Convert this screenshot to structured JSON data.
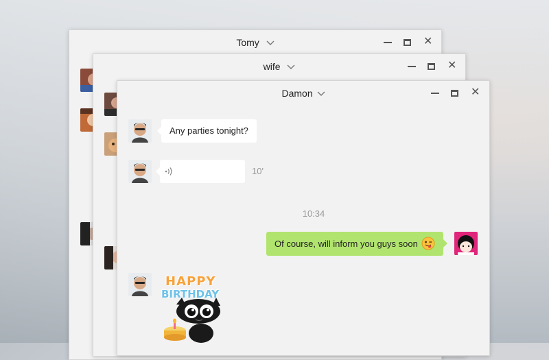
{
  "windows": {
    "back": {
      "title": "Tomy"
    },
    "middle": {
      "title": "wife"
    },
    "front": {
      "title": "Damon"
    }
  },
  "controls": {
    "close": "✕"
  },
  "messages": [
    {
      "from": "Damon",
      "type": "text",
      "text": "Any parties tonight?"
    },
    {
      "from": "Damon",
      "type": "voice",
      "duration": "10'"
    },
    {
      "type": "timestamp",
      "text": "10:34"
    },
    {
      "from": "me",
      "type": "text",
      "text": "Of course, will inform you guys soon"
    },
    {
      "from": "Damon",
      "type": "sticker",
      "text": "HAPPY BIRTHDAY"
    }
  ],
  "sticker": {
    "line1": "HAPPY",
    "line2": "BIRTHDAY"
  },
  "colors": {
    "accent_green": "#b1e46e",
    "window_bg": "#f2f2f2"
  }
}
